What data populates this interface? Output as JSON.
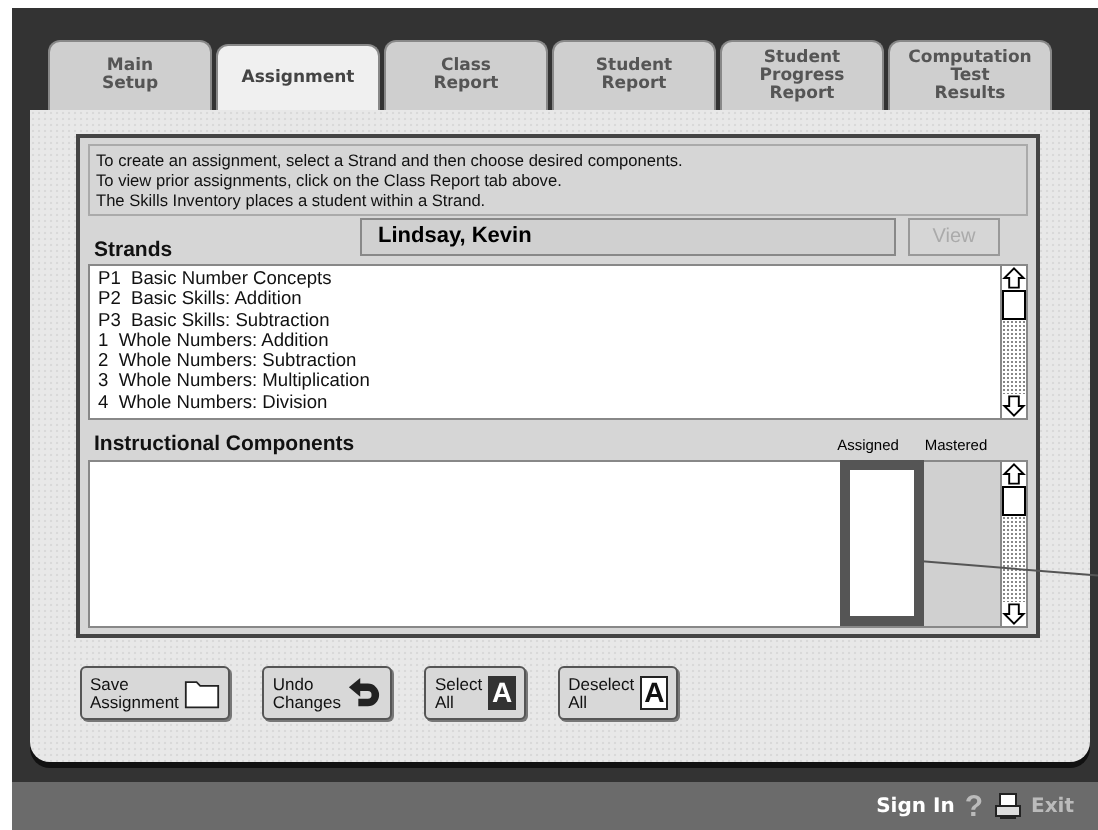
{
  "tabs": [
    {
      "label": "Main\nSetup",
      "selected": false
    },
    {
      "label": "Assignment",
      "selected": true
    },
    {
      "label": "Class\nReport",
      "selected": false
    },
    {
      "label": "Student\nReport",
      "selected": false
    },
    {
      "label": "Student\nProgress\nReport",
      "selected": false
    },
    {
      "label": "Computation\nTest\nResults",
      "selected": false
    }
  ],
  "instructions": [
    "To create an assignment, select a Strand and then choose desired components.",
    "To view prior assignments, click on the Class Report tab above.",
    "The Skills Inventory places a student within a Strand."
  ],
  "strands": {
    "heading": "Strands",
    "student": "Lindsay, Kevin",
    "view_button": {
      "label": "View",
      "disabled": true
    },
    "items": [
      {
        "label": "P1  Basic Number Concepts",
        "selected": false
      },
      {
        "label": "P2  Basic Skills: Addition",
        "selected": false
      },
      {
        "label": "P3  Basic Skills: Subtraction",
        "selected": false
      },
      {
        "label": "1  Whole Numbers: Addition",
        "selected": false
      },
      {
        "label": "2  Whole Numbers: Subtraction",
        "selected": false
      },
      {
        "label": "3  Whole Numbers: Multiplication",
        "selected": false
      },
      {
        "label": "4  Whole Numbers: Division",
        "selected": false
      }
    ]
  },
  "components": {
    "heading": "Instructional Components",
    "columns": [
      "Assigned",
      "Mastered"
    ]
  },
  "buttons": [
    {
      "label": "Save\nAssignment",
      "kind": "folder"
    },
    {
      "label": "Undo\nChanges",
      "kind": "undo"
    },
    {
      "label": "Select\nAll",
      "kind": "letter_filled",
      "glyph": "A"
    },
    {
      "label": "Deselect\nAll",
      "kind": "letter_outline",
      "glyph": "A"
    }
  ],
  "footer": {
    "sign_in": "Sign In",
    "help": "?",
    "exit": {
      "label": "Exit",
      "disabled": true
    }
  }
}
